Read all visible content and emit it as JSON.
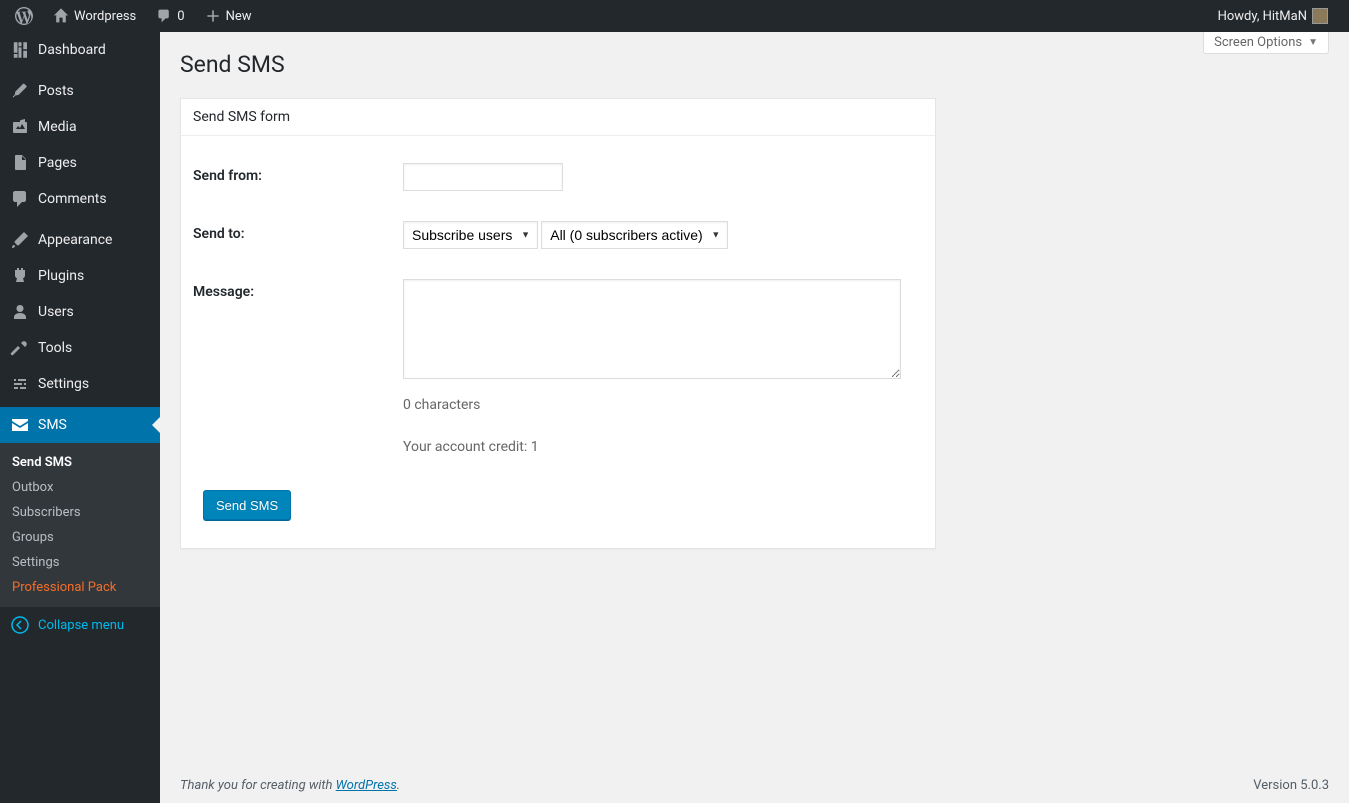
{
  "adminBar": {
    "siteName": "Wordpress",
    "commentCount": "0",
    "newLabel": "New",
    "howdy": "Howdy, HitMaN"
  },
  "sidebar": {
    "items": [
      {
        "label": "Dashboard"
      },
      {
        "label": "Posts"
      },
      {
        "label": "Media"
      },
      {
        "label": "Pages"
      },
      {
        "label": "Comments"
      },
      {
        "label": "Appearance"
      },
      {
        "label": "Plugins"
      },
      {
        "label": "Users"
      },
      {
        "label": "Tools"
      },
      {
        "label": "Settings"
      },
      {
        "label": "SMS"
      }
    ],
    "submenu": [
      {
        "label": "Send SMS",
        "current": true
      },
      {
        "label": "Outbox"
      },
      {
        "label": "Subscribers"
      },
      {
        "label": "Groups"
      },
      {
        "label": "Settings"
      },
      {
        "label": "Professional Pack",
        "highlight": true
      }
    ],
    "collapse": "Collapse menu"
  },
  "page": {
    "title": "Send SMS",
    "screenOptions": "Screen Options",
    "panelTitle": "Send SMS form",
    "labels": {
      "sendFrom": "Send from:",
      "sendTo": "Send to:",
      "message": "Message:"
    },
    "selects": {
      "sendToA": "Subscribe users",
      "sendToB": "All (0 subscribers active)"
    },
    "charCount": "0 characters",
    "creditLine": "Your account credit: 1",
    "submit": "Send SMS"
  },
  "footer": {
    "thanksPrefix": "Thank you for creating with ",
    "wpLink": "WordPress",
    "version": "Version 5.0.3"
  }
}
